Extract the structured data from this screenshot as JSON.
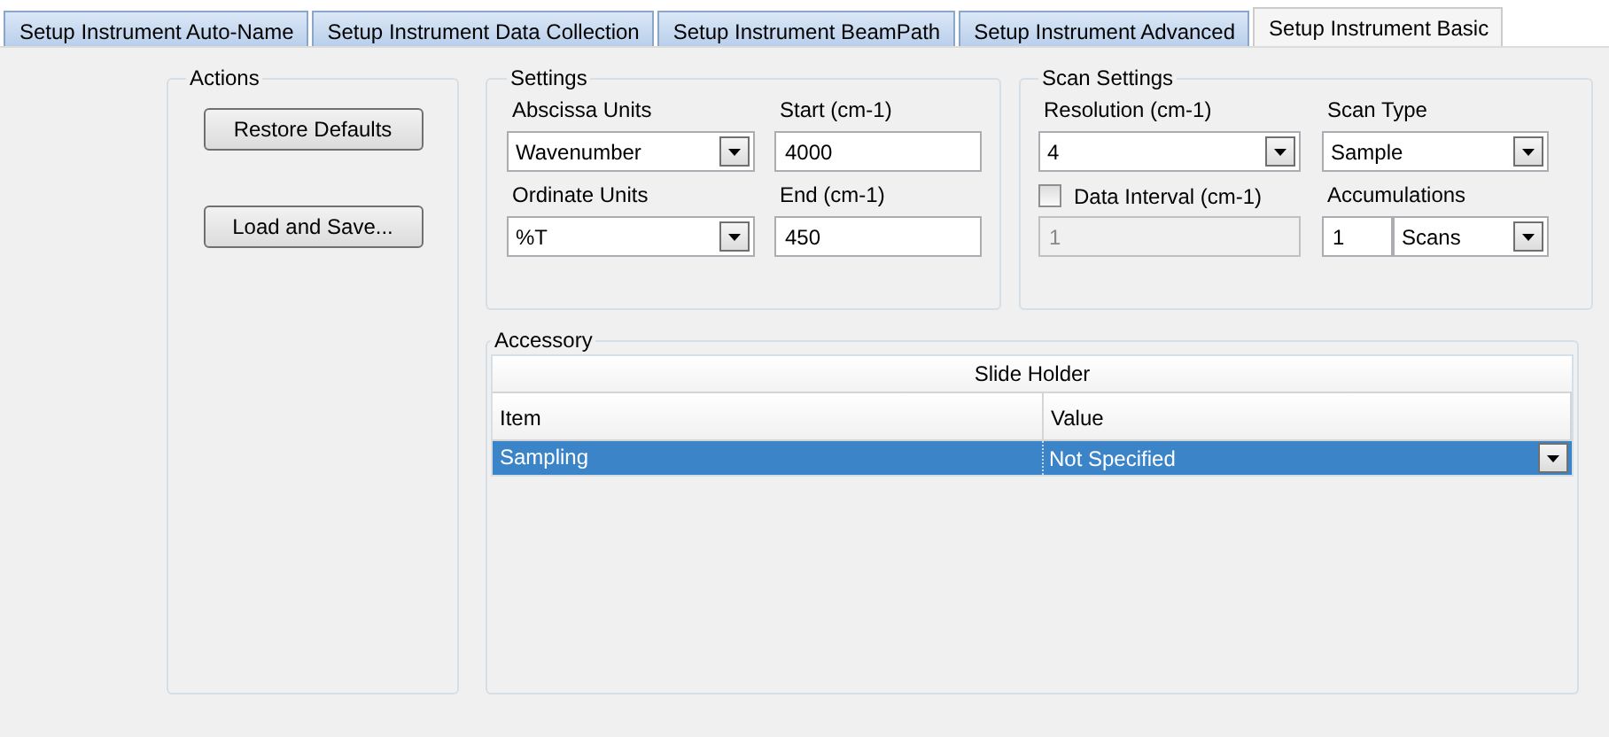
{
  "tabs": [
    {
      "label": "Setup Instrument Auto-Name",
      "selected": false
    },
    {
      "label": "Setup Instrument Data Collection",
      "selected": false
    },
    {
      "label": "Setup Instrument BeamPath",
      "selected": false
    },
    {
      "label": "Setup Instrument Advanced",
      "selected": false
    },
    {
      "label": "Setup Instrument Basic",
      "selected": true
    }
  ],
  "actions": {
    "title": "Actions",
    "buttons": [
      "Restore Defaults",
      "Load and Save..."
    ]
  },
  "settings": {
    "title": "Settings",
    "fields": [
      {
        "label": "Abscissa Units",
        "kind": "dropdown",
        "value": "Wavenumber"
      },
      {
        "label": "Start (cm-1)",
        "kind": "text",
        "value": "4000"
      },
      {
        "label": "Ordinate Units",
        "kind": "dropdown",
        "value": "%T"
      },
      {
        "label": "End (cm-1)",
        "kind": "text",
        "value": "450"
      }
    ]
  },
  "scan_settings": {
    "title": "Scan Settings",
    "resolution": {
      "label": "Resolution (cm-1)",
      "value": "4"
    },
    "scan_type": {
      "label": "Scan Type",
      "value": "Sample"
    },
    "data_interval": {
      "label": "Data Interval (cm-1)",
      "checked": false,
      "value": "1"
    },
    "accumulations": {
      "label": "Accumulations",
      "value": "1",
      "unit": "Scans"
    }
  },
  "accessory": {
    "title": "Accessory",
    "header": "Slide Holder",
    "columns": [
      "Item",
      "Value"
    ],
    "rows": [
      {
        "item": "Sampling",
        "value": "Not Specified",
        "selected": true
      }
    ]
  }
}
